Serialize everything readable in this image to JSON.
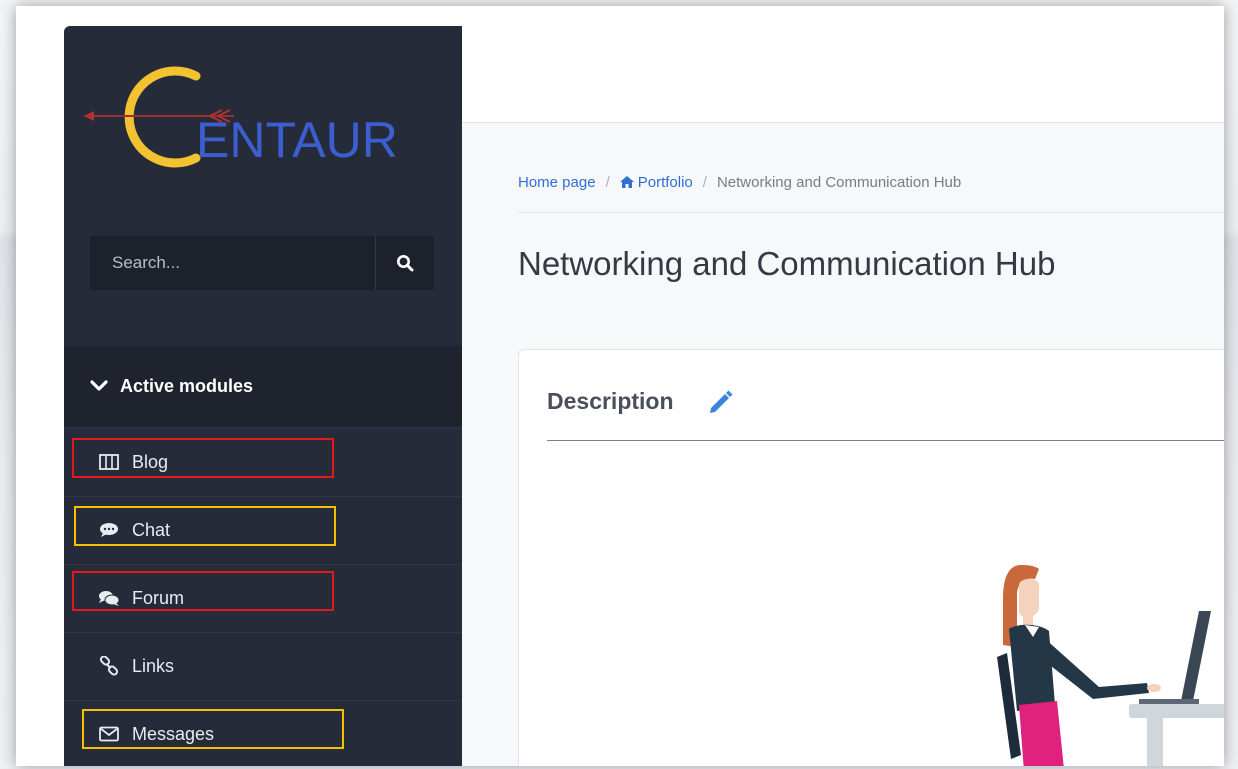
{
  "app": {
    "logo_text": "ENTAUR"
  },
  "sidebar": {
    "search_placeholder": "Search...",
    "modules_header": "Active modules",
    "items": [
      {
        "label": "Blog",
        "icon": "columns-icon"
      },
      {
        "label": "Chat",
        "icon": "comment-icon"
      },
      {
        "label": "Forum",
        "icon": "comments-icon"
      },
      {
        "label": "Links",
        "icon": "link-icon"
      },
      {
        "label": "Messages",
        "icon": "envelope-icon"
      }
    ]
  },
  "breadcrumb": {
    "home": "Home page",
    "sep1": "/",
    "portfolio": "Portfolio",
    "sep2": "/",
    "current": "Networking and Communication Hub"
  },
  "page": {
    "title": "Networking and Communication Hub"
  },
  "card": {
    "title": "Description"
  },
  "highlights": {
    "red": "#e3181b",
    "yellow": "#f5c000"
  },
  "colors": {
    "sidebar": "#252b38",
    "link": "#2f6fd1",
    "logo_yellow": "#f2c230",
    "logo_blue": "#3b5fd0"
  }
}
